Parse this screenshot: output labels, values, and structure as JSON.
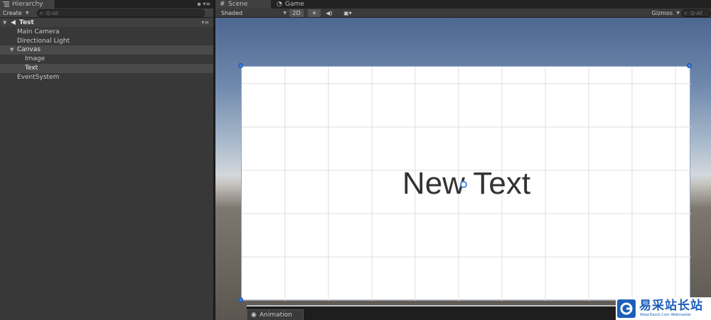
{
  "hierarchy": {
    "tab_label": "Hierarchy",
    "create_label": "Create",
    "search_placeholder": "Q-All",
    "scene_name": "Test",
    "items": [
      {
        "label": "Main Camera"
      },
      {
        "label": "Directional Light"
      },
      {
        "label": "Canvas"
      },
      {
        "label": "Image"
      },
      {
        "label": "Text"
      },
      {
        "label": "EventSystem"
      }
    ]
  },
  "scene_panel": {
    "tabs": [
      {
        "label": "Scene",
        "icon": "grid-icon"
      },
      {
        "label": "Game",
        "icon": "pacman-icon"
      }
    ],
    "toolbar": {
      "shading_mode": "Shaded",
      "mode_2d": "2D",
      "gizmos_label": "Gizmos",
      "search_placeholder": "Q-All"
    },
    "canvas_text": "New Text",
    "bottom_tab_label": "Animation"
  },
  "watermark": {
    "cn_text": "易采站长站",
    "en_text": "Www.Easck.Com Webmaster"
  },
  "colors": {
    "selection_handle": "#3a7de0",
    "sky_top": "#4e6791",
    "ground": "#5c5650"
  }
}
